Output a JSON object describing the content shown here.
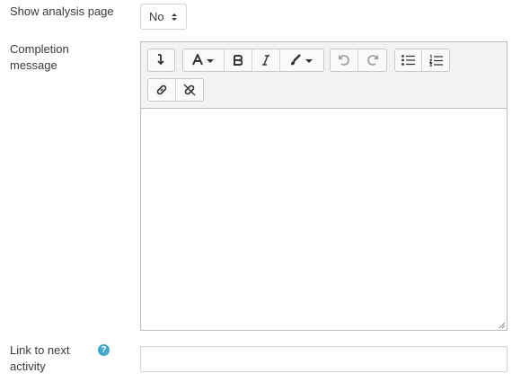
{
  "analysis": {
    "label": "Show analysis page",
    "select_value": "No"
  },
  "completion": {
    "label_line1": "Completion",
    "label_line2": "message",
    "content": ""
  },
  "next_activity": {
    "label_line1": "Link to next",
    "label_line2": "activity",
    "help_glyph": "?",
    "value": ""
  },
  "icons": {
    "toolbar_toggle": "chevron-collapse-icon",
    "font": "font-icon",
    "bold": "bold-icon",
    "italic": "italic-icon",
    "paint": "paintbrush-icon",
    "undo": "undo-icon",
    "redo": "redo-icon",
    "ul": "unordered-list-icon",
    "ol": "ordered-list-icon",
    "link": "link-icon",
    "unlink": "unlink-icon"
  },
  "colors": {
    "help_icon": "#3fa9c7",
    "toolbar_bg": "#f2f2f2"
  }
}
